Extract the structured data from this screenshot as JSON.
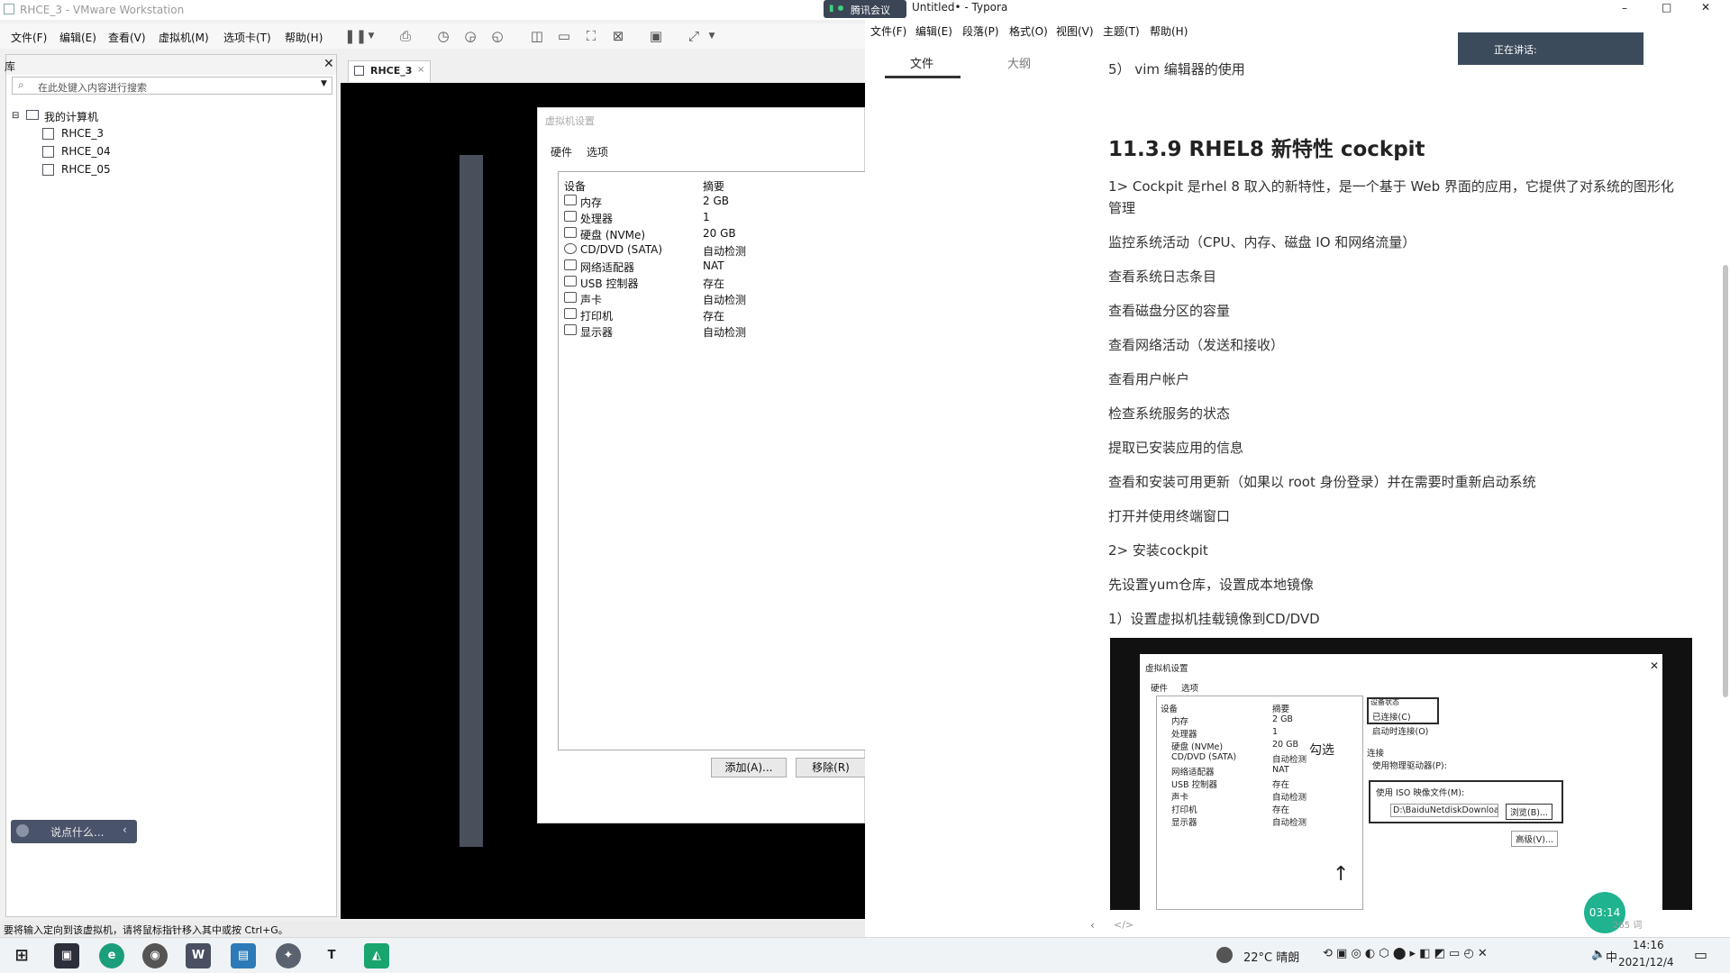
{
  "vmware": {
    "title": "RHCE_3 - VMware Workstation",
    "menu": [
      "文件(F)",
      "编辑(E)",
      "查看(V)",
      "虚拟机(M)",
      "选项卡(T)",
      "帮助(H)"
    ],
    "library": {
      "header": "库",
      "search_placeholder": "在此处键入内容进行搜索",
      "root": "我的计算机",
      "vms": [
        "RHCE_3",
        "RHCE_04",
        "RHCE_05"
      ]
    },
    "tab_label": "RHCE_3",
    "dialog": {
      "title": "虚拟机设置",
      "tabs": [
        "硬件",
        "选项"
      ],
      "col_device": "设备",
      "col_summary": "摘要",
      "devices": [
        {
          "name": "内存",
          "summary": "2 GB"
        },
        {
          "name": "处理器",
          "summary": "1"
        },
        {
          "name": "硬盘 (NVMe)",
          "summary": "20 GB"
        },
        {
          "name": "CD/DVD (SATA)",
          "summary": "自动检测"
        },
        {
          "name": "网络适配器",
          "summary": "NAT"
        },
        {
          "name": "USB 控制器",
          "summary": "存在"
        },
        {
          "name": "声卡",
          "summary": "自动检测"
        },
        {
          "name": "打印机",
          "summary": "存在"
        },
        {
          "name": "显示器",
          "summary": "自动检测"
        }
      ],
      "add_button": "添加(A)...",
      "remove_button": "移除(R)"
    },
    "voice_bar": "说点什么...",
    "status_text": "要将输入定向到该虚拟机，请将鼠标指针移入其中或按 Ctrl+G。"
  },
  "typora": {
    "title": "Untitled• - Typora",
    "meeting_badge": "腾讯会议",
    "menu": [
      "文件(F)",
      "编辑(E)",
      "段落(P)",
      "格式(O)",
      "视图(V)",
      "主题(T)",
      "帮助(H)"
    ],
    "side_tabs": [
      "文件",
      "大纲"
    ],
    "video_label": "正在讲话:",
    "content": {
      "item5": "5） vim 编辑器的使用",
      "heading": "11.3.9 RHEL8 新特性 cockpit",
      "intro_line1": "1> Cockpit 是rhel 8 取入的新特性，是一个基于 Web 界面的应用，它提供了对系统的图形化",
      "intro_line2": "管理",
      "bullets": [
        "监控系统活动（CPU、内存、磁盘 IO 和网络流量）",
        "查看系统日志条目",
        "查看磁盘分区的容量",
        "查看网络活动（发送和接收）",
        "查看用户帐户",
        "检查系统服务的状态",
        "提取已安装应用的信息",
        "查看和安装可用更新（如果以 root 身份登录）并在需要时重新启动系统",
        "打开并使用终端窗口"
      ],
      "install": "2> 安装cockpit",
      "yum": "先设置yum仓库，设置成本地镜像",
      "step1": "1）设置虚拟机挂载镜像到CD/DVD"
    },
    "embedded": {
      "title": "虚拟机设置",
      "tabs": [
        "硬件",
        "选项"
      ],
      "col_device": "设备",
      "col_summary": "摘要",
      "device_status": "设备状态",
      "connected": "已连接(C)",
      "connect_at_power_on": "启动时连接(O)",
      "connection": "连接",
      "use_physical": "使用物理驱动器(P):",
      "use_iso": "使用 ISO 映像文件(M):",
      "iso_path": "D:\\BaiduNetdiskDownload\\r",
      "browse": "浏览(B)...",
      "advanced": "高级(V)...",
      "annotation": "勾选"
    },
    "timer": "03:14",
    "word_count": "265 词"
  },
  "taskbar": {
    "weather": "22°C 晴朗",
    "time": "14:16",
    "date": "2021/12/4",
    "ime": "中"
  }
}
